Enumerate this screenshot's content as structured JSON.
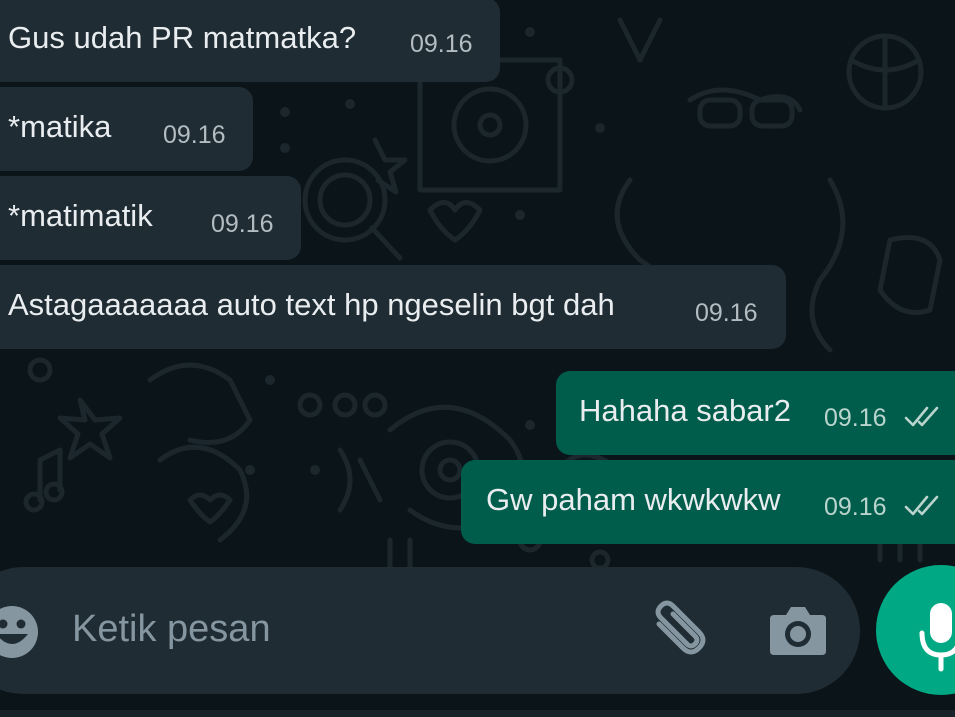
{
  "messages": [
    {
      "direction": "incoming",
      "text": "Gus udah PR matmatka?",
      "time": "09.16"
    },
    {
      "direction": "incoming",
      "text": "*matika",
      "time": "09.16"
    },
    {
      "direction": "incoming",
      "text": "*matimatik",
      "time": "09.16"
    },
    {
      "direction": "incoming",
      "text": "Astagaaaaaaa auto text hp ngeselin bgt dah",
      "time": "09.16"
    },
    {
      "direction": "outgoing",
      "text": "Hahaha sabar2",
      "time": "09.16",
      "status": "delivered-double-check"
    },
    {
      "direction": "outgoing",
      "text": "Gw paham wkwkwkw",
      "time": "09.16",
      "status": "delivered-double-check"
    }
  ],
  "composer": {
    "placeholder": "Ketik pesan",
    "emoji_icon": "emoji-icon",
    "attach_icon": "paperclip-icon",
    "camera_icon": "camera-icon",
    "mic_icon": "microphone-icon"
  },
  "colors": {
    "background": "#0b1418",
    "incoming_bubble": "#1f2c34",
    "outgoing_bubble": "#005c4b",
    "accent": "#00a884",
    "text": "#e9edef",
    "meta_text": "#8696a0"
  }
}
